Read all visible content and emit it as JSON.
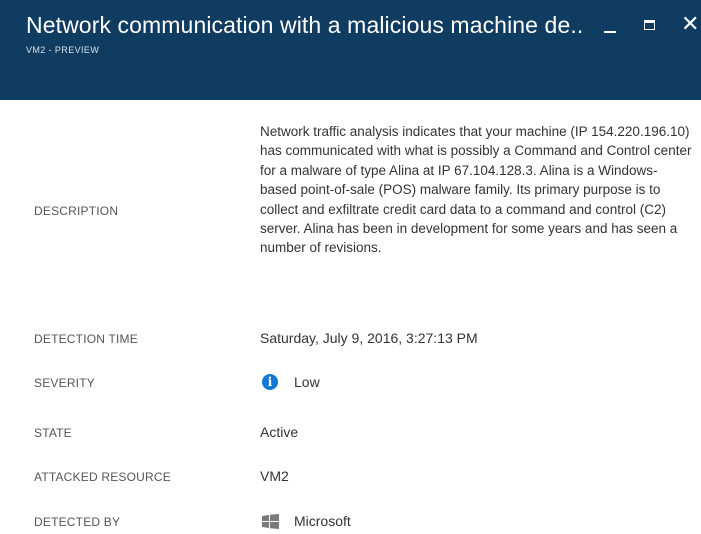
{
  "header": {
    "title": "Network communication with a malicious machine de..",
    "subtitle": "VM2 - PREVIEW",
    "background_color": "#113c62"
  },
  "window_controls": {
    "minimize_icon": "minimize-icon",
    "maximize_icon": "maximize-icon",
    "close_icon": "close-icon",
    "close_glyph": "✕"
  },
  "details": {
    "description": {
      "label": "DESCRIPTION",
      "value": "Network traffic analysis indicates that your machine (IP 154.220.196.10) has communicated with what is possibly a Command and Control center for a malware of type Alina at IP 67.104.128.3. Alina is a Windows-based point-of-sale (POS) malware family. Its primary purpose is to collect and exfiltrate credit card data to a command and control (C2) server. Alina has been in development for some years and has seen a number of revisions."
    },
    "detection_time": {
      "label": "DETECTION TIME",
      "value": "Saturday, July 9, 2016, 3:27:13 PM"
    },
    "severity": {
      "label": "SEVERITY",
      "value": "Low",
      "icon": "info-icon",
      "icon_color": "#0f78d4"
    },
    "state": {
      "label": "STATE",
      "value": "Active"
    },
    "attacked_resource": {
      "label": "ATTACKED RESOURCE",
      "value": "VM2"
    },
    "detected_by": {
      "label": "DETECTED BY",
      "value": "Microsoft",
      "icon": "windows-logo-icon",
      "icon_color": "#7a7a7a"
    }
  }
}
